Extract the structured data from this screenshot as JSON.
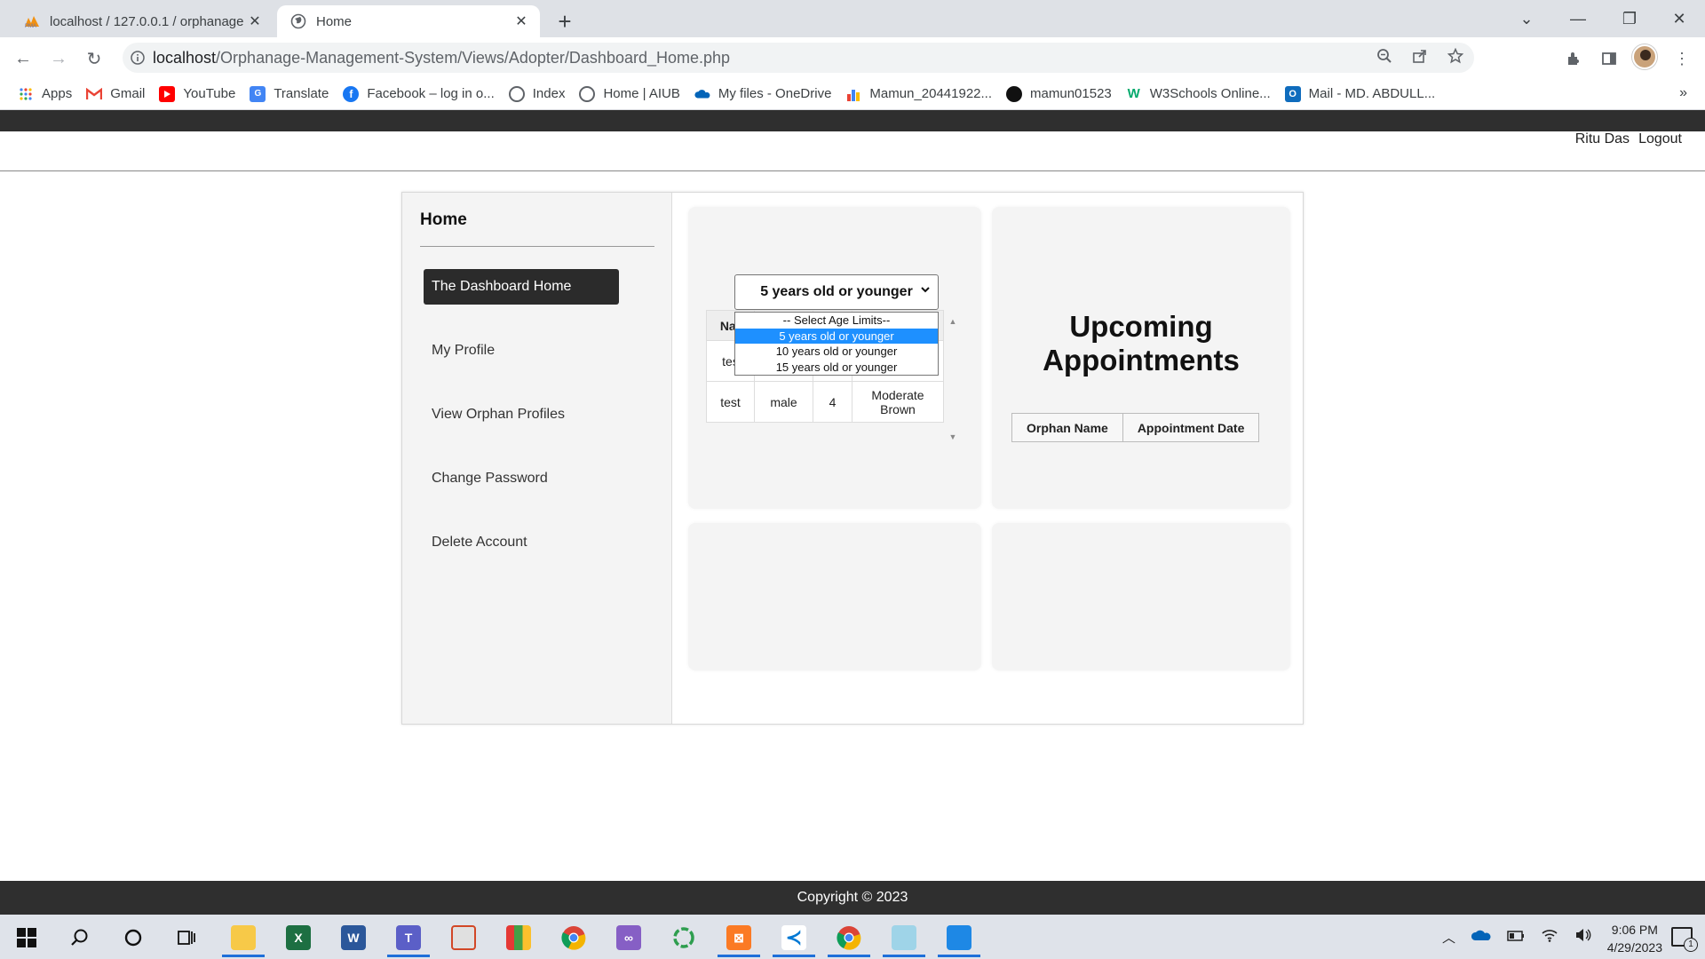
{
  "browser": {
    "tabs": [
      {
        "title": "localhost / 127.0.0.1 / orphanage",
        "icon": "phpmyadmin-icon"
      },
      {
        "title": "Home",
        "icon": "globe-icon"
      }
    ],
    "url_host": "localhost",
    "url_path": "/Orphanage-Management-System/Views/Adopter/Dashboard_Home.php",
    "bookmarks": [
      {
        "label": "Apps",
        "icon": "apps-grid-icon"
      },
      {
        "label": "Gmail",
        "icon": "gmail-icon"
      },
      {
        "label": "YouTube",
        "icon": "youtube-icon"
      },
      {
        "label": "Translate",
        "icon": "translate-icon"
      },
      {
        "label": "Facebook – log in o...",
        "icon": "facebook-icon"
      },
      {
        "label": "Index",
        "icon": "globe-icon"
      },
      {
        "label": "Home | AIUB",
        "icon": "globe-icon"
      },
      {
        "label": "My files - OneDrive",
        "icon": "onedrive-icon"
      },
      {
        "label": "Mamun_20441922...",
        "icon": "chart-icon"
      },
      {
        "label": "mamun01523",
        "icon": "github-icon"
      },
      {
        "label": "W3Schools Online...",
        "icon": "w3schools-icon"
      },
      {
        "label": "Mail - MD. ABDULL...",
        "icon": "outlook-icon"
      }
    ],
    "bookmarks_more": "»"
  },
  "header": {
    "user_name": "Ritu Das",
    "logout_label": "Logout"
  },
  "sidebar": {
    "title": "Home",
    "items": [
      {
        "label": "The Dashboard Home",
        "active": true
      },
      {
        "label": "My Profile",
        "active": false
      },
      {
        "label": "View Orphan Profiles",
        "active": false
      },
      {
        "label": "Change Password",
        "active": false
      },
      {
        "label": "Delete Account",
        "active": false
      }
    ]
  },
  "age_filter": {
    "selected": "5 years old or younger",
    "options": [
      "-- Select Age Limits--",
      "5 years old or younger",
      "10 years old or younger",
      "15 years old or younger"
    ]
  },
  "orphan_table": {
    "header_visible": "Nar",
    "rows": [
      [
        "tes",
        "",
        "",
        ""
      ],
      [
        "test",
        "male",
        "4",
        "Moderate Brown"
      ]
    ]
  },
  "appointments": {
    "title": "Upcoming Appointments",
    "columns": [
      "Orphan Name",
      "Appointment Date"
    ]
  },
  "footer": {
    "copyright": "Copyright © 2023"
  },
  "taskbar": {
    "time": "9:06 PM",
    "date": "4/29/2023",
    "notification_count": "1"
  }
}
